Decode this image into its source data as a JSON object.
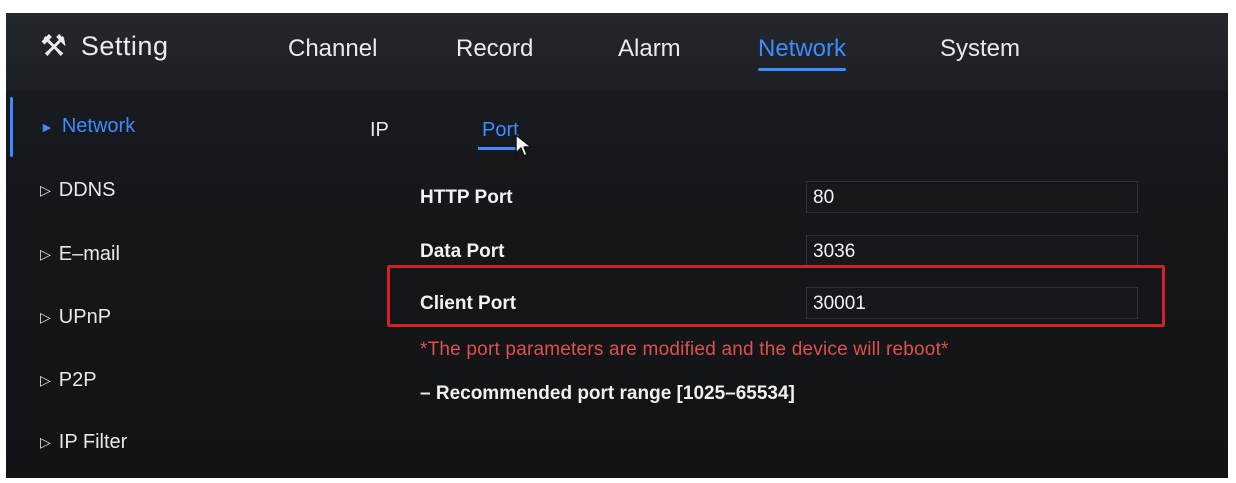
{
  "app": {
    "title": "Setting",
    "icon": "tools-icon"
  },
  "top_tabs": [
    {
      "label": "Channel",
      "active": false
    },
    {
      "label": "Record",
      "active": false
    },
    {
      "label": "Alarm",
      "active": false
    },
    {
      "label": "Network",
      "active": true
    },
    {
      "label": "System",
      "active": false
    }
  ],
  "sidebar": {
    "items": [
      {
        "label": "Network",
        "active": true
      },
      {
        "label": "DDNS",
        "active": false
      },
      {
        "label": "E–mail",
        "active": false
      },
      {
        "label": "UPnP",
        "active": false
      },
      {
        "label": "P2P",
        "active": false
      },
      {
        "label": "IP Filter",
        "active": false
      }
    ]
  },
  "sub_tabs": [
    {
      "label": "IP",
      "active": false
    },
    {
      "label": "Port",
      "active": true
    }
  ],
  "fields": [
    {
      "label": "HTTP Port",
      "value": "80"
    },
    {
      "label": "Data Port",
      "value": "3036"
    },
    {
      "label": "Client Port",
      "value": "30001",
      "highlighted": true
    }
  ],
  "warning": "*The port parameters are modified and the device will reboot*",
  "note": "– Recommended port range [1025–65534]",
  "colors": {
    "accent": "#3d8cff",
    "warning": "#e0504a",
    "highlight": "#d4202a",
    "background": "#15171b"
  }
}
